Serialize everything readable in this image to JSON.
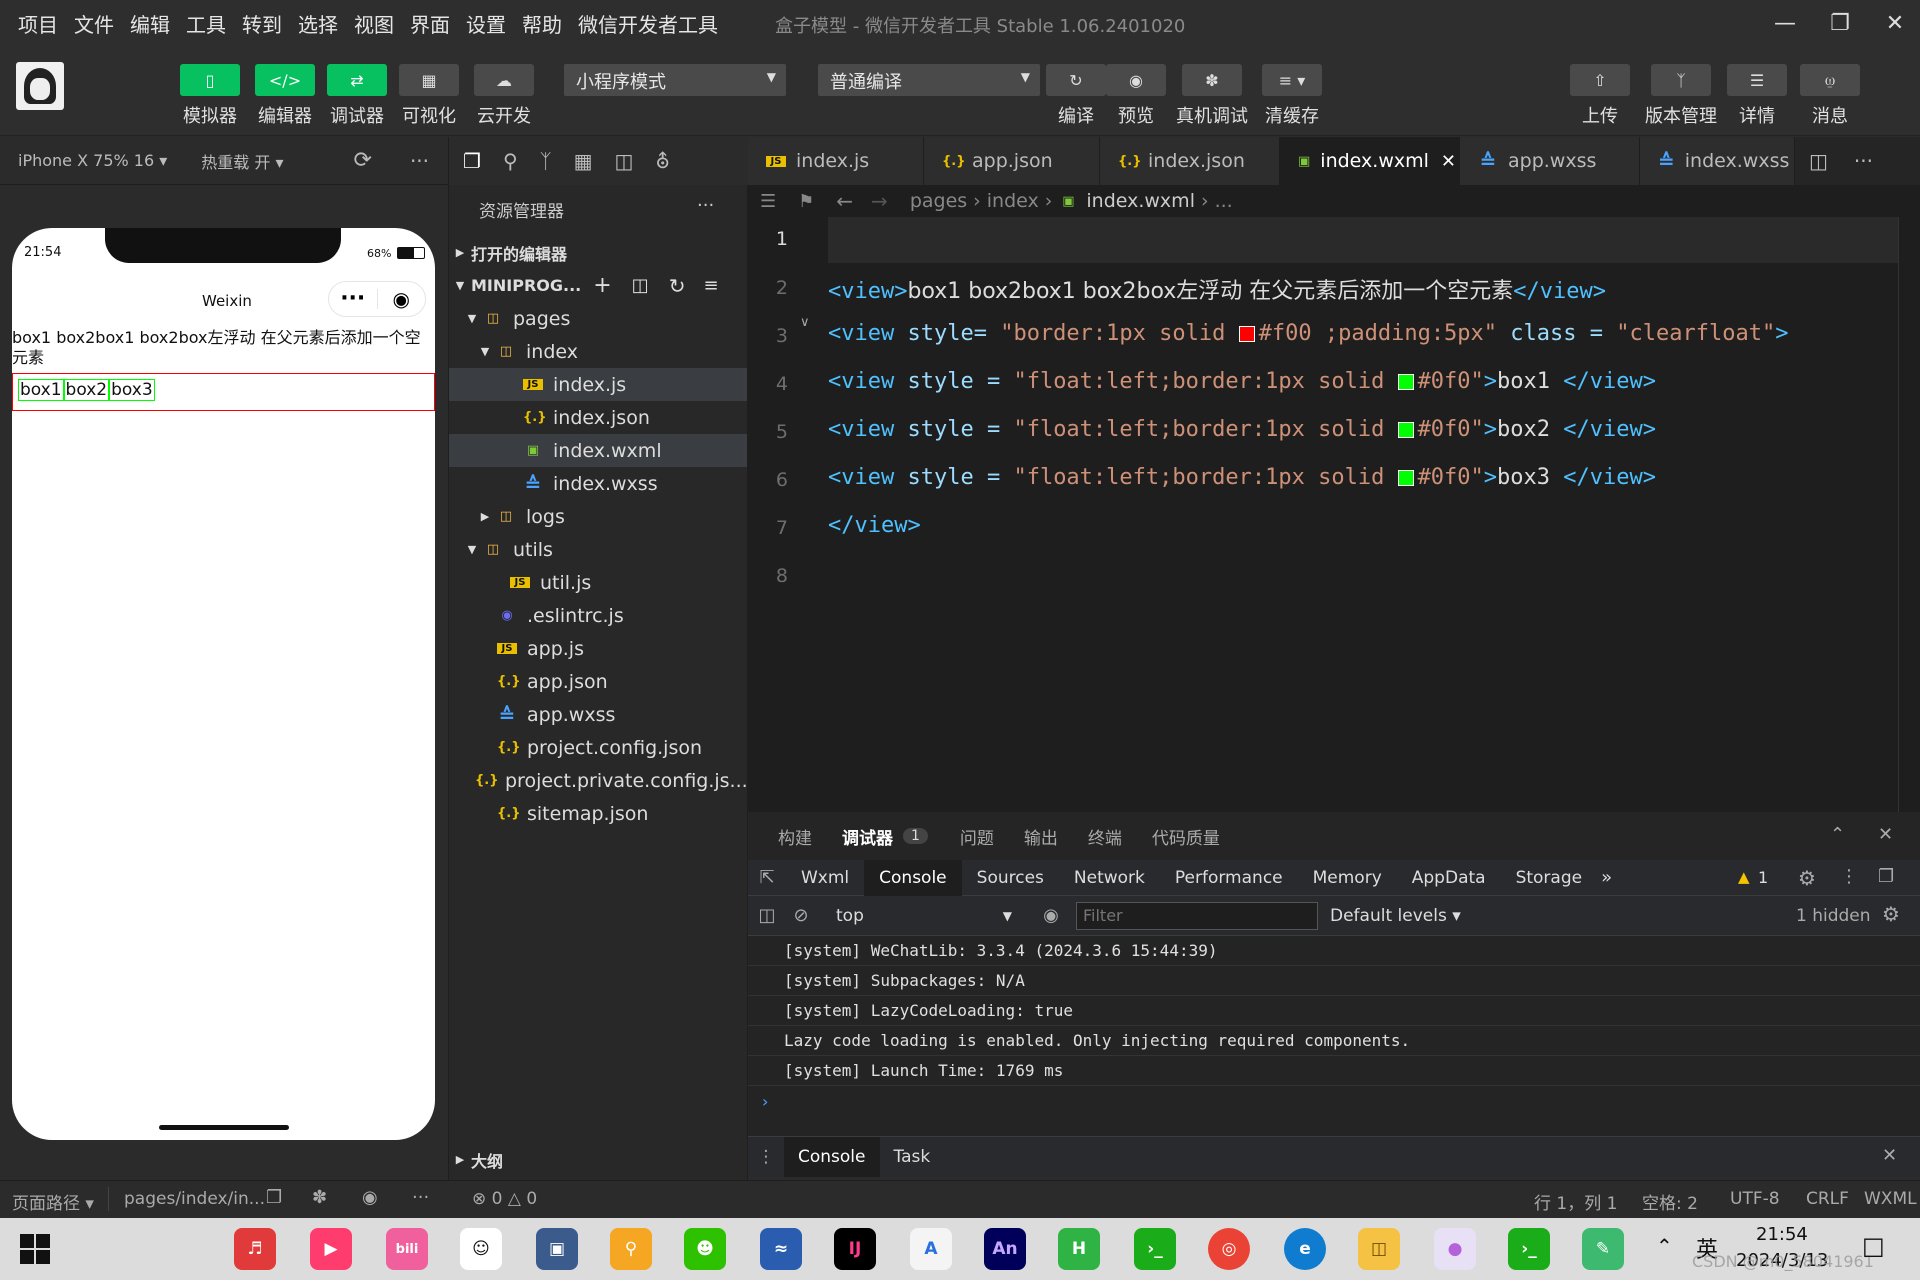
{
  "menu": [
    "项目",
    "文件",
    "编辑",
    "工具",
    "转到",
    "选择",
    "视图",
    "界面",
    "设置",
    "帮助",
    "微信开发者工具"
  ],
  "window_title": "盒子模型 - 微信开发者工具 Stable 1.06.2401020",
  "toolbar": {
    "simulator": "模拟器",
    "editor": "编辑器",
    "debugger": "调试器",
    "visual": "可视化",
    "cloud": "云开发",
    "mode": "小程序模式",
    "compile_mode": "普通编译",
    "compile": "编译",
    "preview": "预览",
    "real_debug": "真机调试",
    "clear_cache": "清缓存",
    "upload": "上传",
    "version": "版本管理",
    "details": "详情",
    "messages": "消息"
  },
  "simulator": {
    "device": "iPhone X 75% 16",
    "hot_reload": "热重载 开",
    "time": "21:54",
    "battery": "68%",
    "nav_title": "Weixin",
    "text_line": "box1 box2box1 box2box左浮动 在父元素后添加一个空元素",
    "boxes": [
      "box1",
      "box2",
      "box3"
    ]
  },
  "explorer": {
    "header": "资源管理器",
    "open_editors": "打开的编辑器",
    "project": "MINIPROG...",
    "tree": [
      {
        "name": "pages",
        "type": "folder",
        "depth": 1,
        "open": true
      },
      {
        "name": "index",
        "type": "folder",
        "depth": 2,
        "open": true
      },
      {
        "name": "index.js",
        "type": "js",
        "depth": 3
      },
      {
        "name": "index.json",
        "type": "json",
        "depth": 3
      },
      {
        "name": "index.wxml",
        "type": "wxml",
        "depth": 3
      },
      {
        "name": "index.wxss",
        "type": "wxss",
        "depth": 3
      },
      {
        "name": "logs",
        "type": "folder",
        "depth": 2,
        "open": false
      },
      {
        "name": "utils",
        "type": "folder",
        "depth": 1,
        "open": true
      },
      {
        "name": "util.js",
        "type": "js",
        "depth": 2
      },
      {
        "name": ".eslintrc.js",
        "type": "eslint",
        "depth": 1
      },
      {
        "name": "app.js",
        "type": "js",
        "depth": 1
      },
      {
        "name": "app.json",
        "type": "json",
        "depth": 1
      },
      {
        "name": "app.wxss",
        "type": "wxss",
        "depth": 1
      },
      {
        "name": "project.config.json",
        "type": "json",
        "depth": 1
      },
      {
        "name": "project.private.config.js...",
        "type": "json",
        "depth": 1
      },
      {
        "name": "sitemap.json",
        "type": "json",
        "depth": 1
      }
    ],
    "outline": "大纲"
  },
  "tabs": [
    "index.js",
    "app.json",
    "index.json",
    "index.wxml",
    "app.wxss",
    "index.wxss"
  ],
  "breadcrumb": [
    "pages",
    "index",
    "index.wxml",
    "..."
  ],
  "code_lines": [
    "1",
    "2",
    "3",
    "4",
    "5",
    "6",
    "7",
    "8"
  ],
  "code": {
    "l2_tag": "<view>",
    "l2_text": "box1 box2box1 box2box左浮动 在父元素后添加一个空元素",
    "l2_close": "</view>",
    "l3_a": "<view ",
    "l3_attr": "style= ",
    "l3_q1": "\"border:1px solid ",
    "l3_color": "#f00",
    "l3_q2": " ;padding:5px\"",
    "l3_class": " class = ",
    "l3_cls": "\"clearfloat\"",
    "l3_end": ">",
    "box_attr": "style = ",
    "box_q1": "\"float:left;border:1px solid ",
    "box_color": "#0f0",
    "box_q2": "\"",
    "box_texts": [
      "box1 ",
      "box2 ",
      "box3 "
    ],
    "close_view": "</view>",
    "swatch_red": "#ff0000",
    "swatch_green": "#00ff00"
  },
  "devtools": {
    "panels": [
      "构建",
      "调试器",
      "问题",
      "输出",
      "终端",
      "代码质量"
    ],
    "debug_badge": "1",
    "tabs": [
      "Wxml",
      "Console",
      "Sources",
      "Network",
      "Performance",
      "Memory",
      "AppData",
      "Storage"
    ],
    "warn_count": "1",
    "context": "top",
    "filter_placeholder": "Filter",
    "levels": "Default levels",
    "hidden": "1 hidden",
    "console_lines": [
      "[system] WeChatLib: 3.3.4 (2024.3.6 15:44:39)",
      "[system] Subpackages: N/A",
      "[system] LazyCodeLoading: true",
      "Lazy code loading is enabled. Only injecting required components.",
      "[system] Launch Time: 1769 ms"
    ],
    "drawer_tabs": [
      "Console",
      "Task"
    ]
  },
  "status": {
    "page_path_label": "页面路径",
    "page_path": "pages/index/in...",
    "errors": "0",
    "warnings": "0",
    "position": "行 1，列 1",
    "spaces": "空格: 2",
    "encoding": "UTF-8",
    "eol": "CRLF",
    "lang": "WXML"
  },
  "taskbar": {
    "ime": "英",
    "time": "21:54",
    "date": "2024/3/13",
    "watermark": "CSDN @m0_58041961"
  }
}
